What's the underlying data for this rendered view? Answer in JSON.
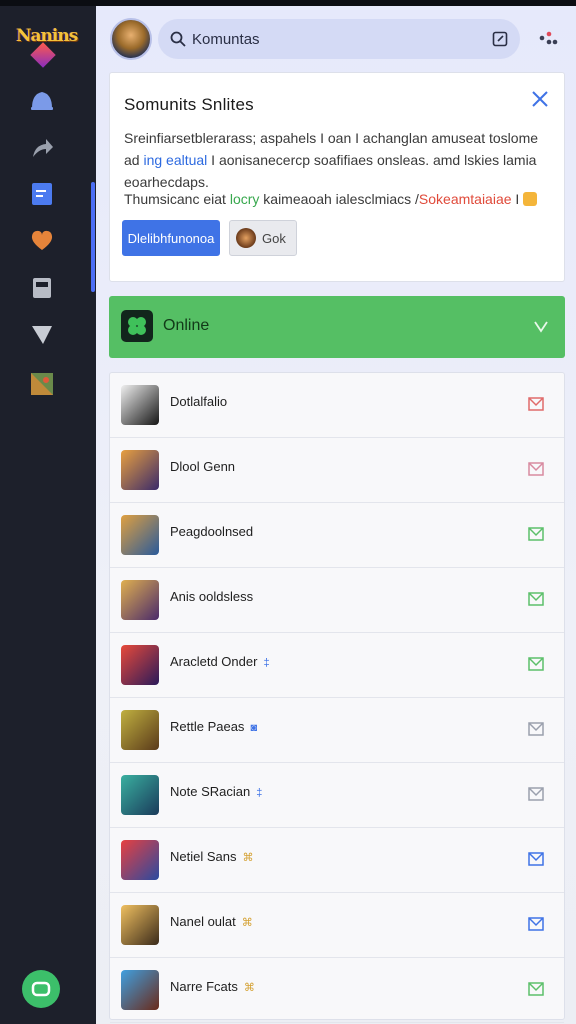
{
  "app": {
    "logo_text": "Nanins"
  },
  "sidebar": {
    "items": [
      {
        "icon": "bell-icon",
        "color": "#7b9ae8"
      },
      {
        "icon": "share-arrow-icon",
        "color": "#9aa0ad"
      },
      {
        "icon": "document-icon",
        "color": "#4c7bf0"
      },
      {
        "icon": "heart-icon",
        "color": "#e6843a"
      },
      {
        "icon": "calendar-icon",
        "color": "#b8bcc6"
      },
      {
        "icon": "filter-icon",
        "color": "#c8ccd4"
      },
      {
        "icon": "game-icon",
        "color": "#c08a3a"
      }
    ],
    "bottom_icon": "chat-icon"
  },
  "header": {
    "search_value": "Komuntas",
    "search_icon": "search-icon",
    "ext_icon": "external-link-icon",
    "menu_icon": "dots-menu-icon"
  },
  "notice": {
    "title": "Somunits Snlites",
    "line1": "Sreinfiarsetblerarass; aspahels I oan I achanglan amuseat toslome",
    "line2_prefix": "ad ",
    "line2_highlight": "ing ealtual",
    "line2_rest": " I aonisanecercp soafifiaes onsleas. amd lskies lamia",
    "line3": "eoarhecdaps.",
    "line4_prefix": "Thumsicanc eiat ",
    "line4_green": "locry",
    "line4_mid": " kaimeaoah ialesclmiacs /",
    "line4_red": "Sokeamtaiaiae",
    "line4_suffix": " I",
    "primary_button": "Dlelibhfunonoa",
    "secondary_button": "Gok",
    "close_icon": "close-icon"
  },
  "online": {
    "label": "Online",
    "icon": "clover-icon",
    "chevron_icon": "chevron-down-icon"
  },
  "contacts": [
    {
      "name": "Dotlalfalio",
      "tag": "",
      "tag_color": "",
      "mail_color": "#e06a6a",
      "c1": "#f0f0f0",
      "c2": "#151515"
    },
    {
      "name": "Dlool Genn",
      "tag": "",
      "tag_color": "",
      "mail_color": "#d88aa0",
      "c1": "#e8a040",
      "c2": "#3a2a6a"
    },
    {
      "name": "Peagdoolnsed",
      "tag": "",
      "tag_color": "",
      "mail_color": "#5cbf6a",
      "c1": "#e0a040",
      "c2": "#2a5a9a"
    },
    {
      "name": "Anis ooldsless",
      "tag": "",
      "tag_color": "",
      "mail_color": "#5cbf6a",
      "c1": "#e0b050",
      "c2": "#4a2a6a"
    },
    {
      "name": "Aracletd Onder",
      "tag": "‡",
      "tag_color": "#3f73e6",
      "mail_color": "#5cbf6a",
      "c1": "#e84a3a",
      "c2": "#2a1a5a"
    },
    {
      "name": "Rettle Paeas",
      "tag": "◙",
      "tag_color": "#3f73e6",
      "mail_color": "#9aa0ad",
      "c1": "#c0b040",
      "c2": "#5a3a1a"
    },
    {
      "name": "Note SRacian",
      "tag": "‡",
      "tag_color": "#3f73e6",
      "mail_color": "#9aa0ad",
      "c1": "#3ab0a0",
      "c2": "#1a3a5a"
    },
    {
      "name": "Netiel Sans",
      "tag": "⌘",
      "tag_color": "#d4a030",
      "mail_color": "#3f73e6",
      "c1": "#e84040",
      "c2": "#2a4aa0"
    },
    {
      "name": "Nanel oulat",
      "tag": "⌘",
      "tag_color": "#d4a030",
      "mail_color": "#3f73e6",
      "c1": "#f0c060",
      "c2": "#3a2a1a"
    },
    {
      "name": "Narre Fcats",
      "tag": "⌘",
      "tag_color": "#d4a030",
      "mail_color": "#5cbf6a",
      "c1": "#40a0e0",
      "c2": "#6a2a1a"
    }
  ]
}
